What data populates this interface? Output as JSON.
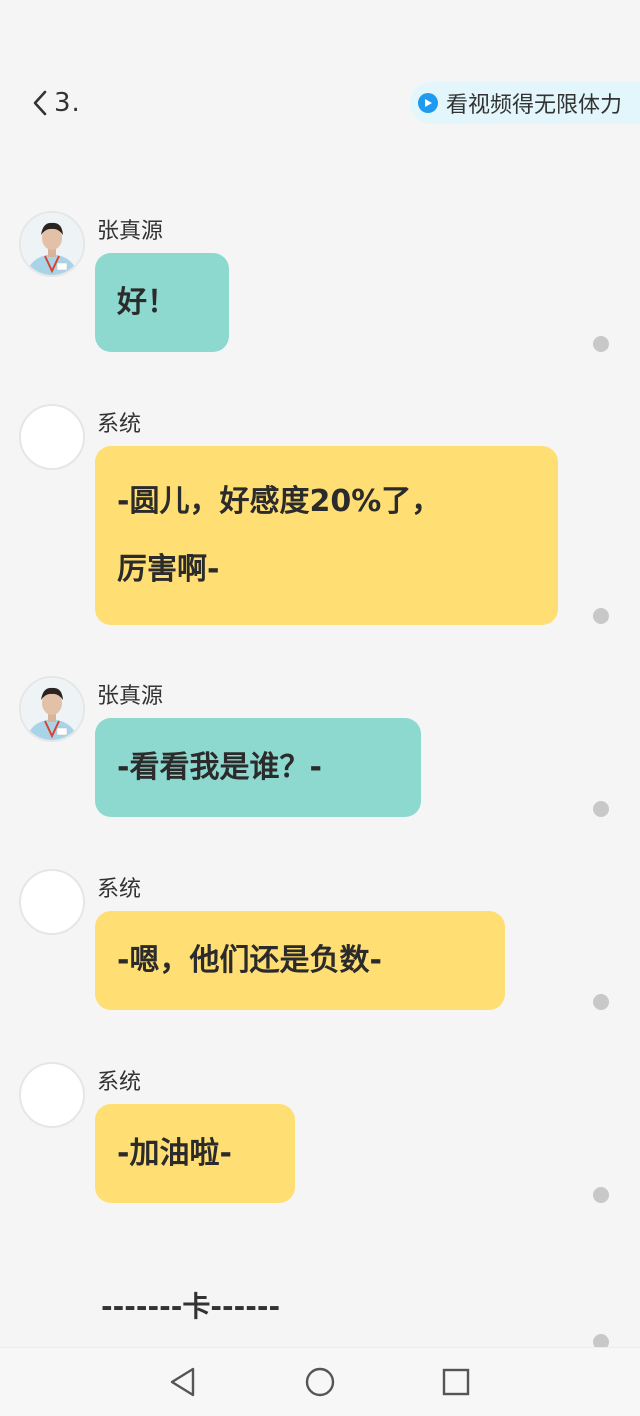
{
  "header": {
    "back_label": "3.",
    "promo_text": "看视频得无限体力"
  },
  "messages": [
    {
      "sender": "张真源",
      "avatar": "photo",
      "bubble_color": "#8dd9cf",
      "lines": [
        "好！"
      ]
    },
    {
      "sender": "系统",
      "avatar": "blank",
      "bubble_color": "#ffdf74",
      "lines": [
        "-圆儿，好感度20%了，",
        "厉害啊-"
      ]
    },
    {
      "sender": "张真源",
      "avatar": "photo",
      "bubble_color": "#8dd9cf",
      "lines": [
        "-看看我是谁？-"
      ]
    },
    {
      "sender": "系统",
      "avatar": "blank",
      "bubble_color": "#ffdf74",
      "lines": [
        "-嗯，他们还是负数-"
      ]
    },
    {
      "sender": "系统",
      "avatar": "blank",
      "bubble_color": "#ffdf74",
      "lines": [
        "-加油啦-"
      ]
    }
  ],
  "footer_divider": "-------卡------",
  "navbar": {
    "icons": [
      "back-triangle-icon",
      "home-circle-icon",
      "recents-square-icon"
    ]
  }
}
